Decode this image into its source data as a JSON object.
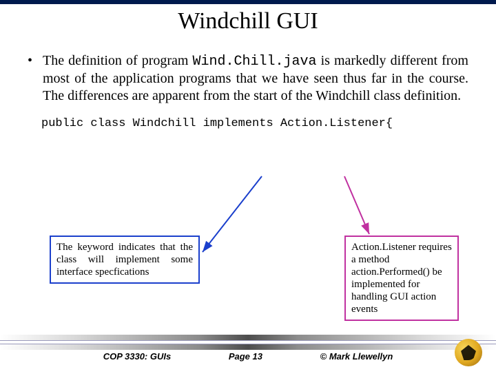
{
  "title": "Windchill GUI",
  "bullet": "•",
  "paragraph_pre": "The definition of program ",
  "paragraph_code": "Wind.Chill.java",
  "paragraph_post": " is markedly different from most of the application programs that we have seen thus far in the course.  The differences are apparent from the start of the Windchill class definition.",
  "code_line": "public class Windchill implements Action.Listener{",
  "callout_blue": "The keyword indicates that the class will implement some interface specfications",
  "callout_magenta": "Action.Listener requires a method action.Performed() be implemented for handling GUI action events",
  "footer": {
    "course": "COP 3330:  GUIs",
    "page": "Page 13",
    "copyright": "© Mark Llewellyn"
  }
}
